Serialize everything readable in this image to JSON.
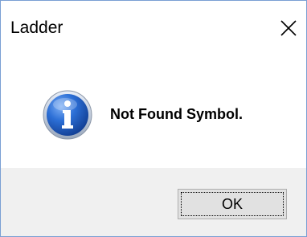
{
  "window": {
    "title": "Ladder",
    "close_icon": "close-icon"
  },
  "message": {
    "icon": "information-icon",
    "text": "Not Found Symbol."
  },
  "buttons": {
    "ok_label": "OK"
  },
  "colors": {
    "footer_background": "#f0f0f0",
    "button_background": "#e1e1e1",
    "info_icon_blue": "#1e5bbf"
  }
}
